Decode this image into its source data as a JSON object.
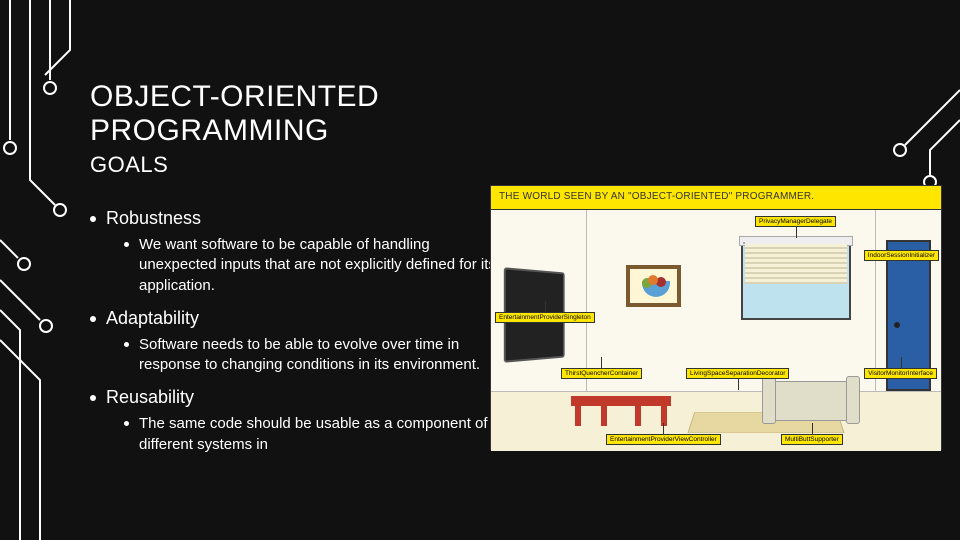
{
  "slide": {
    "title": "OBJECT-ORIENTED PROGRAMMING",
    "subtitle": "GOALS",
    "bullets": [
      {
        "heading": "Robustness",
        "sub": "We want software to be capable of handling unexpected inputs that are not explicitly defined for its application."
      },
      {
        "heading": "Adaptability",
        "sub": "Software needs to be able to evolve over time in response to changing conditions in its environment."
      },
      {
        "heading": "Reusability",
        "sub": "The same code should be usable as a component of different systems in"
      }
    ]
  },
  "cartoon": {
    "caption": "THE WORLD SEEN BY AN \"OBJECT-ORIENTED\" PROGRAMMER.",
    "labels": {
      "privacy": "PrivacyManagerDelegate",
      "indoor": "IndoorSessionInitializer",
      "entertainment": "EntertainmentProviderSingleton",
      "thirst": "ThirstQuencherContainer",
      "living": "LivingSpaceSeparationDecorator",
      "visitor": "VisitorMonitorInterface",
      "entcontrol": "EntertainmentProviderViewController",
      "multibutt": "MultiButtSupporter"
    }
  }
}
